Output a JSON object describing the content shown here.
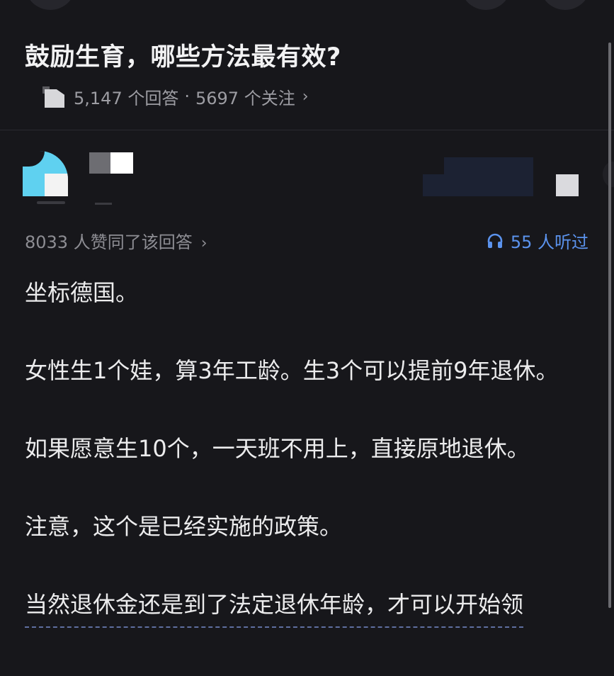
{
  "question": {
    "title": "鼓励生育，哪些方法最有效?",
    "answers_count": "5,147 个回答",
    "separator": "·",
    "followers_count": "5697 个关注",
    "chevron": "›"
  },
  "answer": {
    "vote_text": "8033 人赞同了该回答",
    "vote_chevron": "›",
    "listen_text": "55 人听过",
    "listen_icon": "headphones-icon",
    "paragraphs": [
      "坐标德国。",
      "女性生1个娃，算3年工龄。生3个可以提前9年退休。",
      "如果愿意生10个，一天班不用上，直接原地退休。",
      "注意，这个是已经实施的政策。",
      "当然退休金还是到了法定退休年龄，才可以开始领"
    ]
  },
  "colors": {
    "background": "#17171b",
    "accent_blue": "#5b93ee",
    "text_primary": "#ececed",
    "text_secondary": "#9d9da3"
  }
}
